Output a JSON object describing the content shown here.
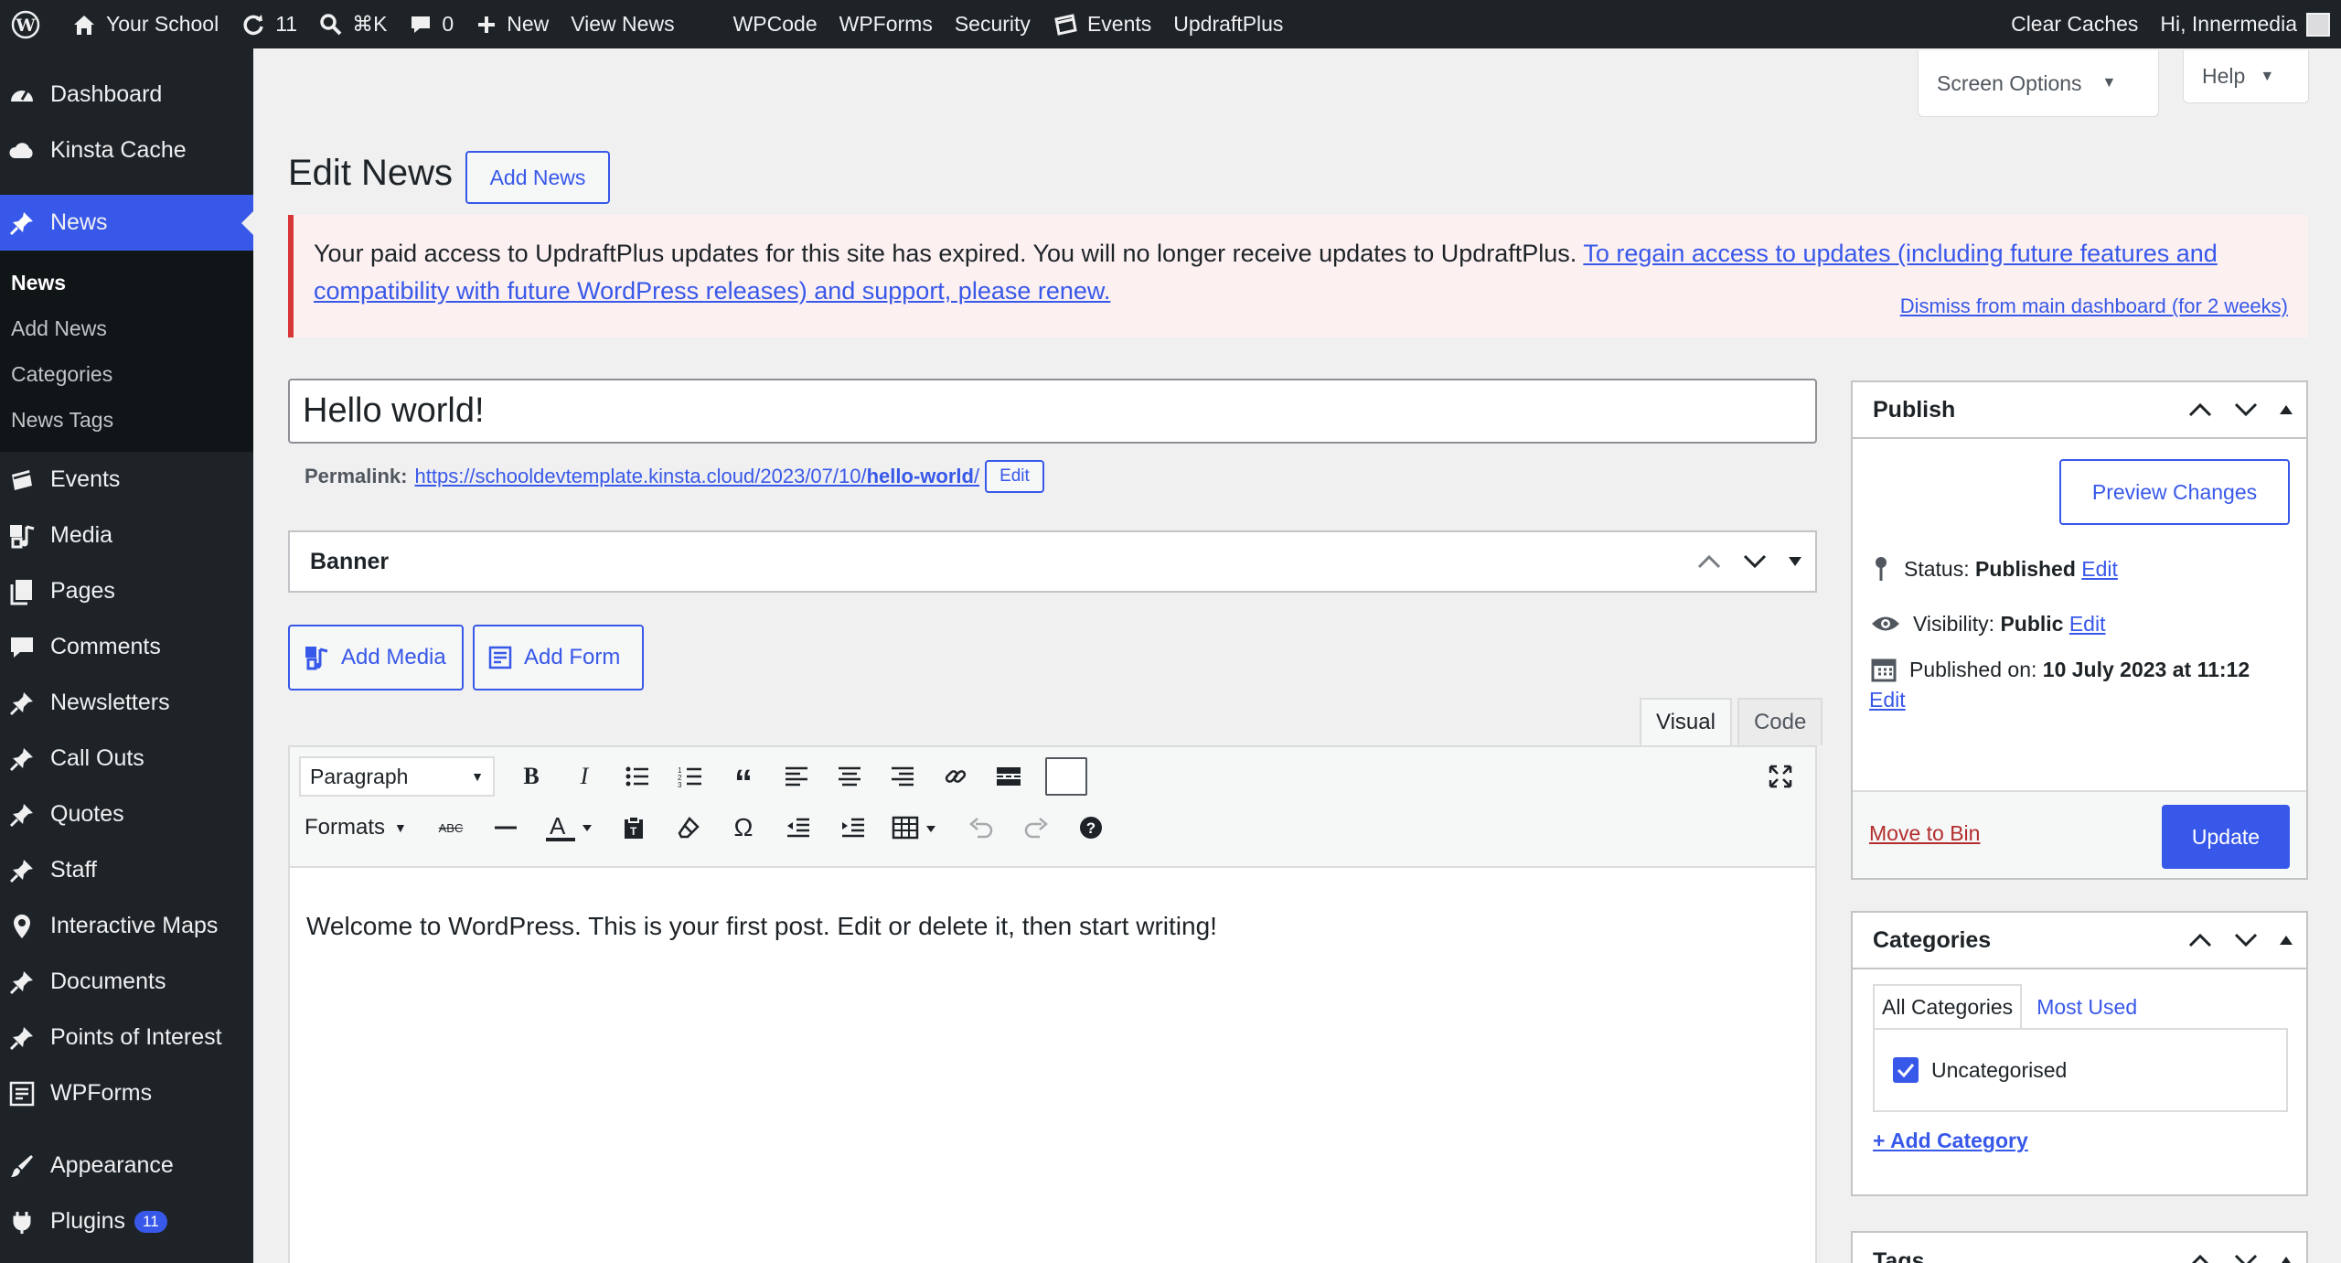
{
  "adminbar": {
    "site_name": "Your School",
    "updates_count": "11",
    "search_shortcut": "⌘K",
    "comments_count": "0",
    "new_label": "New",
    "view_label": "View News",
    "menu": [
      "WPCode",
      "WPForms",
      "Security",
      "Events",
      "UpdraftPlus"
    ],
    "clear_caches": "Clear Caches",
    "greeting": "Hi, Innermedia"
  },
  "sidebar": {
    "items_top": [
      {
        "label": "Dashboard",
        "icon": "dashboard-icon"
      },
      {
        "label": "Kinsta Cache",
        "icon": "cloud-icon"
      }
    ],
    "active": {
      "label": "News",
      "icon": "pin-icon"
    },
    "submenu": [
      "News",
      "Add News",
      "Categories",
      "News Tags"
    ],
    "items_bottom": [
      {
        "label": "Events",
        "icon": "calendar-icon"
      },
      {
        "label": "Media",
        "icon": "media-icon"
      },
      {
        "label": "Pages",
        "icon": "pages-icon"
      },
      {
        "label": "Comments",
        "icon": "comment-icon"
      },
      {
        "label": "Newsletters",
        "icon": "pin-icon"
      },
      {
        "label": "Call Outs",
        "icon": "pin-icon"
      },
      {
        "label": "Quotes",
        "icon": "pin-icon"
      },
      {
        "label": "Staff",
        "icon": "pin-icon"
      },
      {
        "label": "Interactive Maps",
        "icon": "location-icon"
      },
      {
        "label": "Documents",
        "icon": "pin-icon"
      },
      {
        "label": "Points of Interest",
        "icon": "pin-icon"
      },
      {
        "label": "WPForms",
        "icon": "form-icon"
      }
    ],
    "appearance": "Appearance",
    "plugins": "Plugins",
    "plugins_badge": "11"
  },
  "screen_options": "Screen Options",
  "help": "Help",
  "page_title": "Edit News",
  "add_news_button": "Add News",
  "notice": {
    "text": "Your paid access to UpdraftPlus updates for this site has expired. You will no longer receive updates to UpdraftPlus. ",
    "link": "To regain access to updates (including future features and compatibility with future WordPress releases) and support, please renew.",
    "dismiss": "Dismiss from main dashboard (for 2 weeks)"
  },
  "post_title": "Hello world!",
  "permalink": {
    "label": "Permalink:",
    "base": "https://schooldevtemplate.kinsta.cloud/2023/07/10/",
    "slug": "hello-world",
    "trail": "/",
    "edit": "Edit"
  },
  "banner_title": "Banner",
  "add_media": "Add Media",
  "add_form": "Add Form",
  "tab_visual": "Visual",
  "tab_code": "Code",
  "format_select": "Paragraph",
  "formats_label": "Formats",
  "content_text": "Welcome to WordPress. This is your first post. Edit or delete it, then start writing!",
  "publish": {
    "title": "Publish",
    "preview": "Preview Changes",
    "status_label": "Status:",
    "status_value": "Published",
    "visibility_label": "Visibility:",
    "visibility_value": "Public",
    "published_label": "Published on:",
    "published_value": "10 July 2023 at 11:12",
    "edit": "Edit",
    "move_to_bin": "Move to Bin",
    "update": "Update"
  },
  "categories": {
    "title": "Categories",
    "tab_all": "All Categories",
    "tab_most": "Most Used",
    "items": [
      {
        "label": "Uncategorised",
        "checked": true
      }
    ],
    "add": "+ Add Category"
  },
  "tags": {
    "title": "Tags"
  },
  "colors": {
    "accent": "#3858e9",
    "sidebar": "#1d2327",
    "notice_border": "#d63638"
  }
}
